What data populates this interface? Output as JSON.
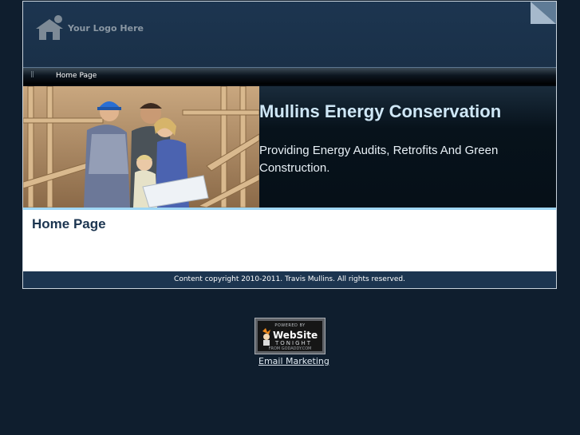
{
  "header": {
    "logo_text": "Your Logo Here"
  },
  "nav": {
    "items": [
      {
        "label": "Home Page"
      }
    ]
  },
  "hero": {
    "title": "Mullins Energy Conservation",
    "subtitle": "Providing Energy Audits, Retrofits And Green Construction."
  },
  "main": {
    "heading": "Home Page"
  },
  "footer": {
    "copyright": "Content copyright 2010-2011. Travis Mullins. All rights reserved."
  },
  "badge": {
    "powered_by": "POWERED BY",
    "brand": "WebSite",
    "tonight": "TONIGHT",
    "from": "FROM GODADDY.COM"
  },
  "links": {
    "email_marketing": "Email Marketing"
  },
  "colors": {
    "page_background": "#0f1e2e",
    "header_background": "#1c3550",
    "title_color": "#cfe7f6",
    "heading_color": "#1c3550",
    "accent_bar": "#9fd7f5"
  },
  "icons": {
    "logo": "house-icon",
    "corner": "page-curl-icon",
    "nav_handle": "grip-icon"
  }
}
